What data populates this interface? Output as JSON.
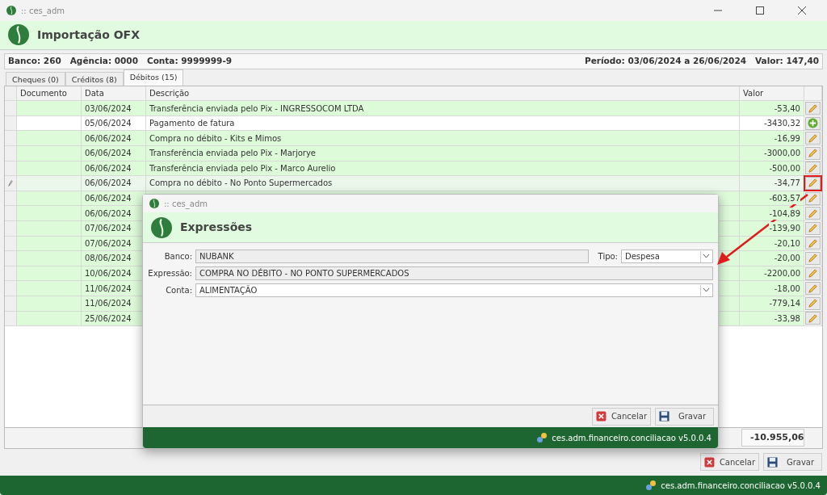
{
  "window": {
    "title": ":: ces_adm"
  },
  "header": {
    "title": "Importação OFX"
  },
  "info": {
    "left": "Banco: 260   Agência: 0000   Conta: 9999999-9",
    "right": "Período: 03/06/2024 a 26/06/2024   Valor: 147,40"
  },
  "tabs": [
    {
      "label": "Cheques (0)",
      "selected": false
    },
    {
      "label": "Créditos (8)",
      "selected": false
    },
    {
      "label": "Débitos (15)",
      "selected": true
    }
  ],
  "table": {
    "columns": [
      "Documento",
      "Data",
      "Descrição",
      "Valor"
    ],
    "rows": [
      {
        "date": "03/06/2024",
        "description": "Transferência enviada pelo Pix - INGRESSOCOM LTDA",
        "value": "-53,40",
        "matched": true,
        "selected": false,
        "kind": "edit",
        "highlighted": false
      },
      {
        "date": "05/06/2024",
        "description": "Pagamento de fatura",
        "value": "-3430,32",
        "matched": false,
        "selected": false,
        "kind": "add",
        "highlighted": false
      },
      {
        "date": "06/06/2024",
        "description": "Compra no débito - Kits e Mimos",
        "value": "-16,99",
        "matched": true,
        "selected": false,
        "kind": "edit",
        "highlighted": false
      },
      {
        "date": "06/06/2024",
        "description": "Transferência enviada pelo Pix - Marjorye",
        "value": "-3000,00",
        "matched": true,
        "selected": false,
        "kind": "edit",
        "highlighted": false
      },
      {
        "date": "06/06/2024",
        "description": "Transferência enviada pelo Pix - Marco Aurelio",
        "value": "-500,00",
        "matched": true,
        "selected": false,
        "kind": "edit",
        "highlighted": false
      },
      {
        "date": "06/06/2024",
        "description": "Compra no débito - No Ponto Supermercados",
        "value": "-34,77",
        "matched": true,
        "selected": true,
        "kind": "edit",
        "highlighted": true
      },
      {
        "date": "06/06/2024",
        "value": "-603,57",
        "matched": true,
        "selected": false,
        "kind": "edit",
        "highlighted": false
      },
      {
        "date": "06/06/2024",
        "value": "-104,89",
        "matched": true,
        "selected": false,
        "kind": "edit",
        "highlighted": false
      },
      {
        "date": "07/06/2024",
        "value": "-139,90",
        "matched": true,
        "selected": false,
        "kind": "edit",
        "highlighted": false
      },
      {
        "date": "07/06/2024",
        "value": "-20,10",
        "matched": true,
        "selected": false,
        "kind": "edit",
        "highlighted": false
      },
      {
        "date": "08/06/2024",
        "value": "-20,00",
        "matched": true,
        "selected": false,
        "kind": "edit",
        "highlighted": false
      },
      {
        "date": "10/06/2024",
        "value": "-2200,00",
        "matched": true,
        "selected": false,
        "kind": "edit",
        "highlighted": false
      },
      {
        "date": "11/06/2024",
        "value": "-18,00",
        "matched": true,
        "selected": false,
        "kind": "edit",
        "highlighted": false
      },
      {
        "date": "11/06/2024",
        "value": "-779,14",
        "matched": true,
        "selected": false,
        "kind": "edit",
        "highlighted": false
      },
      {
        "date": "25/06/2024",
        "value": "-33,98",
        "matched": true,
        "selected": false,
        "kind": "edit",
        "highlighted": false
      }
    ],
    "total": "-10.955,06"
  },
  "buttons": [
    "Cancelar",
    "Gravar"
  ],
  "status_bar": "ces.adm.financeiro.conciliacao v5.0.0.4",
  "dialog": {
    "window_title": ":: ces_adm",
    "title": "Expressões",
    "fields": [
      {
        "label": "Banco:",
        "value": "NUBANK",
        "kind": "readonly"
      },
      {
        "label": "Tipo:",
        "value": "Despesa",
        "kind": "select"
      },
      {
        "label": "Expressão:",
        "value": "COMPRA NO DÉBITO - NO PONTO SUPERMERCADOS",
        "kind": "readonly"
      },
      {
        "label": "Conta:",
        "value": "ALIMENTAÇÃO",
        "kind": "select"
      }
    ],
    "buttons": [
      "Cancelar",
      "Gravar"
    ],
    "status_bar": "ces.adm.financeiro.conciliacao v5.0.0.4"
  }
}
